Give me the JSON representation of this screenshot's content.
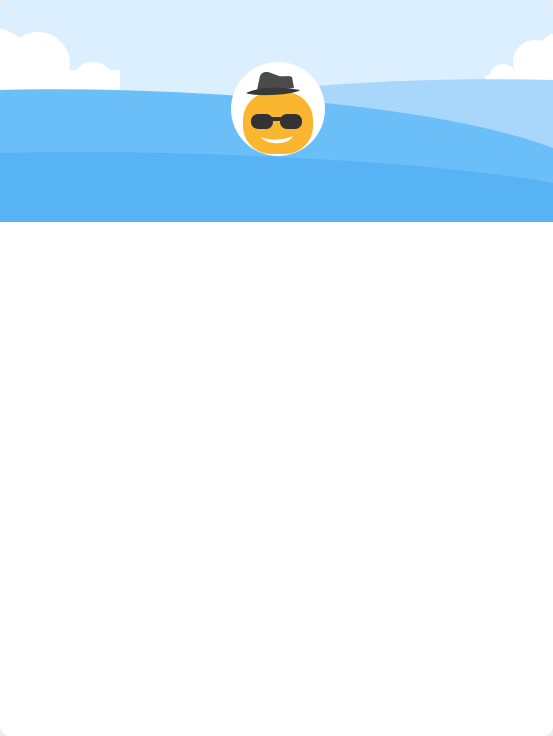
{
  "profile_header": {
    "sky_color": "#dcefff",
    "wave_back_color": "#a9d6fb",
    "wave_mid_color": "#6bbff8",
    "wave_front_color": "#58b3f5",
    "cloud_color": "#ffffff"
  },
  "avatar": {
    "icon": "cool-face-with-hat-icon",
    "face_color": "#fbb630",
    "hat_color": "#4a4a4a",
    "glasses_color": "#333333",
    "ring_color": "#ffffff"
  },
  "content": {}
}
